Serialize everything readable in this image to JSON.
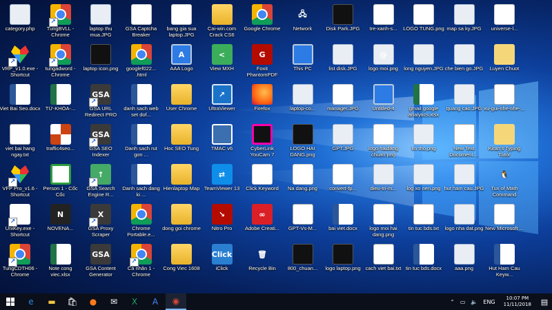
{
  "desktop": {
    "icons": [
      {
        "label": "category.php",
        "icon": "image-file-icon",
        "style": "i-img",
        "glyph": ""
      },
      {
        "label": "TungBVLL - Chrome",
        "icon": "chrome-icon",
        "style": "i-chrome",
        "glyph": "",
        "shortcut": true
      },
      {
        "label": "laptop thu mua.JPG",
        "icon": "image-file-icon",
        "style": "i-img",
        "glyph": ""
      },
      {
        "label": "GSA Captcha Breaker",
        "icon": "barcode-icon",
        "style": "i-white",
        "glyph": "|||"
      },
      {
        "label": "bang gia sua laptop.JPG",
        "icon": "image-file-icon",
        "style": "i-white",
        "glyph": ""
      },
      {
        "label": "Cai-win.com Crack CS6",
        "icon": "folder-zip-icon",
        "style": "i-folder",
        "glyph": ""
      },
      {
        "label": "Google Chrome",
        "icon": "chrome-icon",
        "style": "i-chrome",
        "glyph": ""
      },
      {
        "label": "Network",
        "icon": "network-icon",
        "style": "i-network",
        "glyph": "🖧"
      },
      {
        "label": "Disk Park.JPG",
        "icon": "image-file-icon",
        "style": "i-blackimg",
        "glyph": ""
      },
      {
        "label": "tre-xanh-s...",
        "icon": "image-file-icon",
        "style": "i-white",
        "glyph": ""
      },
      {
        "label": "LOGO TUNG.png",
        "icon": "image-file-icon",
        "style": "i-white",
        "glyph": ""
      },
      {
        "label": "map sa ky.JPG",
        "icon": "image-file-icon",
        "style": "i-img",
        "glyph": ""
      },
      {
        "label": "universe-l...",
        "icon": "image-file-icon",
        "style": "i-white",
        "glyph": ""
      },
      {
        "label": "VRP_v1.0.exe - Shortcut",
        "icon": "vfp-app-icon",
        "style": "i-vfp",
        "glyph": "",
        "shortcut": true
      },
      {
        "label": "tungadword - Chrome",
        "icon": "chrome-icon",
        "style": "i-chrome",
        "glyph": "",
        "shortcut": true
      },
      {
        "label": "laptop icon.png",
        "icon": "laptop-image-icon",
        "style": "i-blackimg",
        "glyph": ""
      },
      {
        "label": "googlef022... .html",
        "icon": "chrome-html-icon",
        "style": "i-chrome",
        "glyph": ""
      },
      {
        "label": "AAA Logo",
        "icon": "aaa-logo-icon",
        "style": "i-monitor",
        "glyph": "A"
      },
      {
        "label": "View MXH",
        "icon": "share-icon",
        "style": "i-share",
        "glyph": "<"
      },
      {
        "label": "Foxit PhantomPDF",
        "icon": "foxit-pdf-icon",
        "style": "i-pdf",
        "glyph": "G"
      },
      {
        "label": "This PC",
        "icon": "monitor-icon",
        "style": "i-monitor",
        "glyph": ""
      },
      {
        "label": "list disk.JPG",
        "icon": "image-file-icon",
        "style": "i-img",
        "glyph": ""
      },
      {
        "label": "logo moi.png",
        "icon": "image-file-icon",
        "style": "i-img",
        "glyph": "@"
      },
      {
        "label": "long nguyen.JPG",
        "icon": "image-file-icon",
        "style": "i-img",
        "glyph": ""
      },
      {
        "label": "che bien go.JPG",
        "icon": "image-file-icon",
        "style": "i-img",
        "glyph": ""
      },
      {
        "label": "Luyen Chuot",
        "icon": "cookie-app-icon",
        "style": "i-lion",
        "glyph": ""
      },
      {
        "label": "Viet Bai Seo.docx",
        "icon": "word-doc-icon",
        "style": "i-word",
        "glyph": "W"
      },
      {
        "label": "TỪ-KHÓA-...",
        "icon": "excel-file-icon",
        "style": "i-excel",
        "glyph": "X"
      },
      {
        "label": "GSA URL Redirect PRO",
        "icon": "gsa-icon",
        "style": "i-gsa",
        "glyph": "GSA",
        "shortcut": true
      },
      {
        "label": "danh sach web set dof...",
        "icon": "word-doc-icon",
        "style": "i-word",
        "glyph": "W"
      },
      {
        "label": "User Chrome",
        "icon": "folder-icon",
        "style": "i-folder",
        "glyph": ""
      },
      {
        "label": "UltraViewer",
        "icon": "ultraviewer-icon",
        "style": "i-ultra",
        "glyph": "↗"
      },
      {
        "label": "Firefox",
        "icon": "firefox-icon",
        "style": "i-firefox",
        "glyph": ""
      },
      {
        "label": "laptop-co...",
        "icon": "image-file-icon",
        "style": "i-img",
        "glyph": ""
      },
      {
        "label": "manager.JPG",
        "icon": "image-file-icon",
        "style": "i-white",
        "glyph": ""
      },
      {
        "label": "Untitled-4",
        "icon": "image-file-icon",
        "style": "i-monitor",
        "glyph": ""
      },
      {
        "label": "gmail google analytics.xlsx",
        "icon": "excel-file-icon",
        "style": "i-excel",
        "glyph": "X"
      },
      {
        "label": "quang cao.JPG",
        "icon": "image-file-icon",
        "style": "i-img",
        "glyph": ""
      },
      {
        "label": "xu-gui-nhe-nhe-...",
        "icon": "text-file-icon",
        "style": "i-txt",
        "glyph": ""
      },
      {
        "label": "viet bai hang ngay.txt",
        "icon": "text-file-icon",
        "style": "i-txt",
        "glyph": ""
      },
      {
        "label": "traffic4seo...",
        "icon": "swirl-app-icon",
        "style": "i-swirl",
        "glyph": ""
      },
      {
        "label": "GSA SEO Indexer",
        "icon": "gsa-icon",
        "style": "i-gsa",
        "glyph": "GSA",
        "shortcut": true
      },
      {
        "label": "Danh sach rut gon ...",
        "icon": "word-doc-icon",
        "style": "i-word",
        "glyph": "W"
      },
      {
        "label": "Hoc SEO Tung",
        "icon": "folder-icon",
        "style": "i-folder",
        "glyph": ""
      },
      {
        "label": "TMAC v6",
        "icon": "maze-icon",
        "style": "i-maze",
        "glyph": ""
      },
      {
        "label": "CyberLink YouCam 7",
        "icon": "cyberlink-icon",
        "style": "i-cyber",
        "glyph": ""
      },
      {
        "label": "LOGO HAI DANG.png",
        "icon": "image-file-icon",
        "style": "i-blackimg",
        "glyph": ""
      },
      {
        "label": "GPT.JPG",
        "icon": "image-file-icon",
        "style": "i-img",
        "glyph": ""
      },
      {
        "label": "logo haidang chuan.png",
        "icon": "image-file-icon",
        "style": "i-white",
        "glyph": ""
      },
      {
        "label": "lm tho.png",
        "icon": "image-file-icon",
        "style": "i-img",
        "glyph": ""
      },
      {
        "label": "New Text Document....",
        "icon": "text-file-icon",
        "style": "i-txt",
        "glyph": ""
      },
      {
        "label": "Kiran's Typing Tutor",
        "icon": "typing-tutor-icon",
        "style": "i-lion",
        "glyph": ""
      },
      {
        "label": "VFP Pro_v1.6 - Shortcut",
        "icon": "vfp-app-icon",
        "style": "i-vfp",
        "glyph": "",
        "shortcut": true
      },
      {
        "label": "Person 1 - Cốc Cốc",
        "icon": "coccoc-icon",
        "style": "i-koc",
        "glyph": ""
      },
      {
        "label": "GSA Search Engine R...",
        "icon": "arrow-up-icon",
        "style": "i-arrowup",
        "glyph": "↑",
        "shortcut": true
      },
      {
        "label": "Danh sach dang ki ...",
        "icon": "word-doc-icon",
        "style": "i-word",
        "glyph": "W"
      },
      {
        "label": "Hienlaptop Map",
        "icon": "folder-icon",
        "style": "i-folder",
        "glyph": ""
      },
      {
        "label": "TeamViewer 13",
        "icon": "teamviewer-icon",
        "style": "i-teamviewer",
        "glyph": "⇄"
      },
      {
        "label": "Click Keyword",
        "icon": "mouse-app-icon",
        "style": "i-white",
        "glyph": ""
      },
      {
        "label": "Na dang.png",
        "icon": "image-file-icon",
        "style": "i-white",
        "glyph": ""
      },
      {
        "label": "convert-fp...",
        "icon": "image-file-icon",
        "style": "i-white",
        "glyph": ""
      },
      {
        "label": "dieu-tri-m...",
        "icon": "image-file-icon",
        "style": "i-img",
        "glyph": ""
      },
      {
        "label": "log xo nen.png",
        "icon": "image-file-icon",
        "style": "i-img",
        "glyph": ""
      },
      {
        "label": "hut ham cau.JPG",
        "icon": "image-file-icon",
        "style": "i-img",
        "glyph": ""
      },
      {
        "label": "Tux of Math Command",
        "icon": "tux-icon",
        "style": "i-linux",
        "glyph": "🐧"
      },
      {
        "label": "UniKey.exe - Shortcut",
        "icon": "unikey-icon",
        "style": "i-uni",
        "glyph": "U",
        "shortcut": true
      },
      {
        "label": "NOVENA...",
        "icon": "novena-icon",
        "style": "i-novena",
        "glyph": "N"
      },
      {
        "label": "GSA Proxy Scraper",
        "icon": "gsa-icon",
        "style": "i-gsa",
        "glyph": "X",
        "shortcut": true
      },
      {
        "label": "Chrome Portable.e...",
        "icon": "chrome-icon",
        "style": "i-chrome",
        "glyph": ""
      },
      {
        "label": "dong goi chrome",
        "icon": "folder-icon",
        "style": "i-folder",
        "glyph": ""
      },
      {
        "label": "Nitro Pro",
        "icon": "nitro-pdf-icon",
        "style": "i-pdf",
        "glyph": "↘"
      },
      {
        "label": "Adobe Creati...",
        "icon": "adobe-icon",
        "style": "i-adobe",
        "glyph": "∞"
      },
      {
        "label": "GPT-Vs-M...",
        "icon": "text-file-icon",
        "style": "i-txt",
        "glyph": ""
      },
      {
        "label": "bai viet.docx",
        "icon": "word-doc-icon",
        "style": "i-word",
        "glyph": "W"
      },
      {
        "label": "logo moi hai dang.png",
        "icon": "image-file-icon",
        "style": "i-white",
        "glyph": ""
      },
      {
        "label": "tin tuc bds.txt",
        "icon": "text-file-icon",
        "style": "i-txt",
        "glyph": ""
      },
      {
        "label": "logo nha dat.png",
        "icon": "image-file-icon",
        "style": "i-img",
        "glyph": ""
      },
      {
        "label": "New Microsoft ...",
        "icon": "text-file-icon",
        "style": "i-white",
        "glyph": ""
      },
      {
        "label": "TungCDTH06 - Chrome",
        "icon": "chrome-icon",
        "style": "i-chrome",
        "glyph": "",
        "shortcut": true
      },
      {
        "label": "Note cong viec.xlsx",
        "icon": "excel-file-icon",
        "style": "i-excel",
        "glyph": "X"
      },
      {
        "label": "GSA Content Generator",
        "icon": "gsa-icon",
        "style": "i-gsa",
        "glyph": "GSA"
      },
      {
        "label": "Cá nhân 1 - Chrome",
        "icon": "chrome-icon",
        "style": "i-chrome",
        "glyph": "",
        "shortcut": true
      },
      {
        "label": "Cong Viec 1608",
        "icon": "folder-icon",
        "style": "i-folder",
        "glyph": ""
      },
      {
        "label": "iClick",
        "icon": "iclick-icon",
        "style": "i-click",
        "glyph": "Click"
      },
      {
        "label": "Recycle Bin",
        "icon": "recycle-bin-icon",
        "style": "i-recycle",
        "glyph": "🗑"
      },
      {
        "label": "800_chuan...",
        "icon": "image-file-icon",
        "style": "i-blackimg",
        "glyph": ""
      },
      {
        "label": "logo laptop.png",
        "icon": "image-file-icon",
        "style": "i-blackimg",
        "glyph": ""
      },
      {
        "label": "cach viet bai.txt",
        "icon": "text-file-icon",
        "style": "i-txt",
        "glyph": ""
      },
      {
        "label": "tin tuc bds.docx",
        "icon": "word-doc-icon",
        "style": "i-word",
        "glyph": "W"
      },
      {
        "label": "aaa.png",
        "icon": "image-file-icon",
        "style": "i-img",
        "glyph": ""
      },
      {
        "label": "Hut Ham Cau Keyw...",
        "icon": "word-doc-icon",
        "style": "i-word",
        "glyph": "W"
      }
    ],
    "rows": [
      13,
      13,
      13,
      13,
      13,
      13,
      13
    ]
  },
  "taskbar": {
    "pinned": [
      {
        "name": "edge-icon",
        "glyph": "e",
        "color": "#2f87e0"
      },
      {
        "name": "file-explorer-icon",
        "glyph": "▬",
        "color": "#f2c744"
      },
      {
        "name": "store-icon",
        "glyph": "🛍",
        "color": "#ffffff"
      },
      {
        "name": "firefox-icon",
        "glyph": "●",
        "color": "#ff7a1a"
      },
      {
        "name": "mail-icon",
        "glyph": "✉",
        "color": "#ffffff"
      },
      {
        "name": "excel-icon",
        "glyph": "X",
        "color": "#21a366"
      },
      {
        "name": "google-ads-icon",
        "glyph": "A",
        "color": "#4285f4"
      },
      {
        "name": "chrome-icon",
        "glyph": "◉",
        "color": "#db4437"
      }
    ],
    "tray": {
      "language": "ENG",
      "time": "10:07 PM",
      "date": "11/11/2018"
    }
  }
}
